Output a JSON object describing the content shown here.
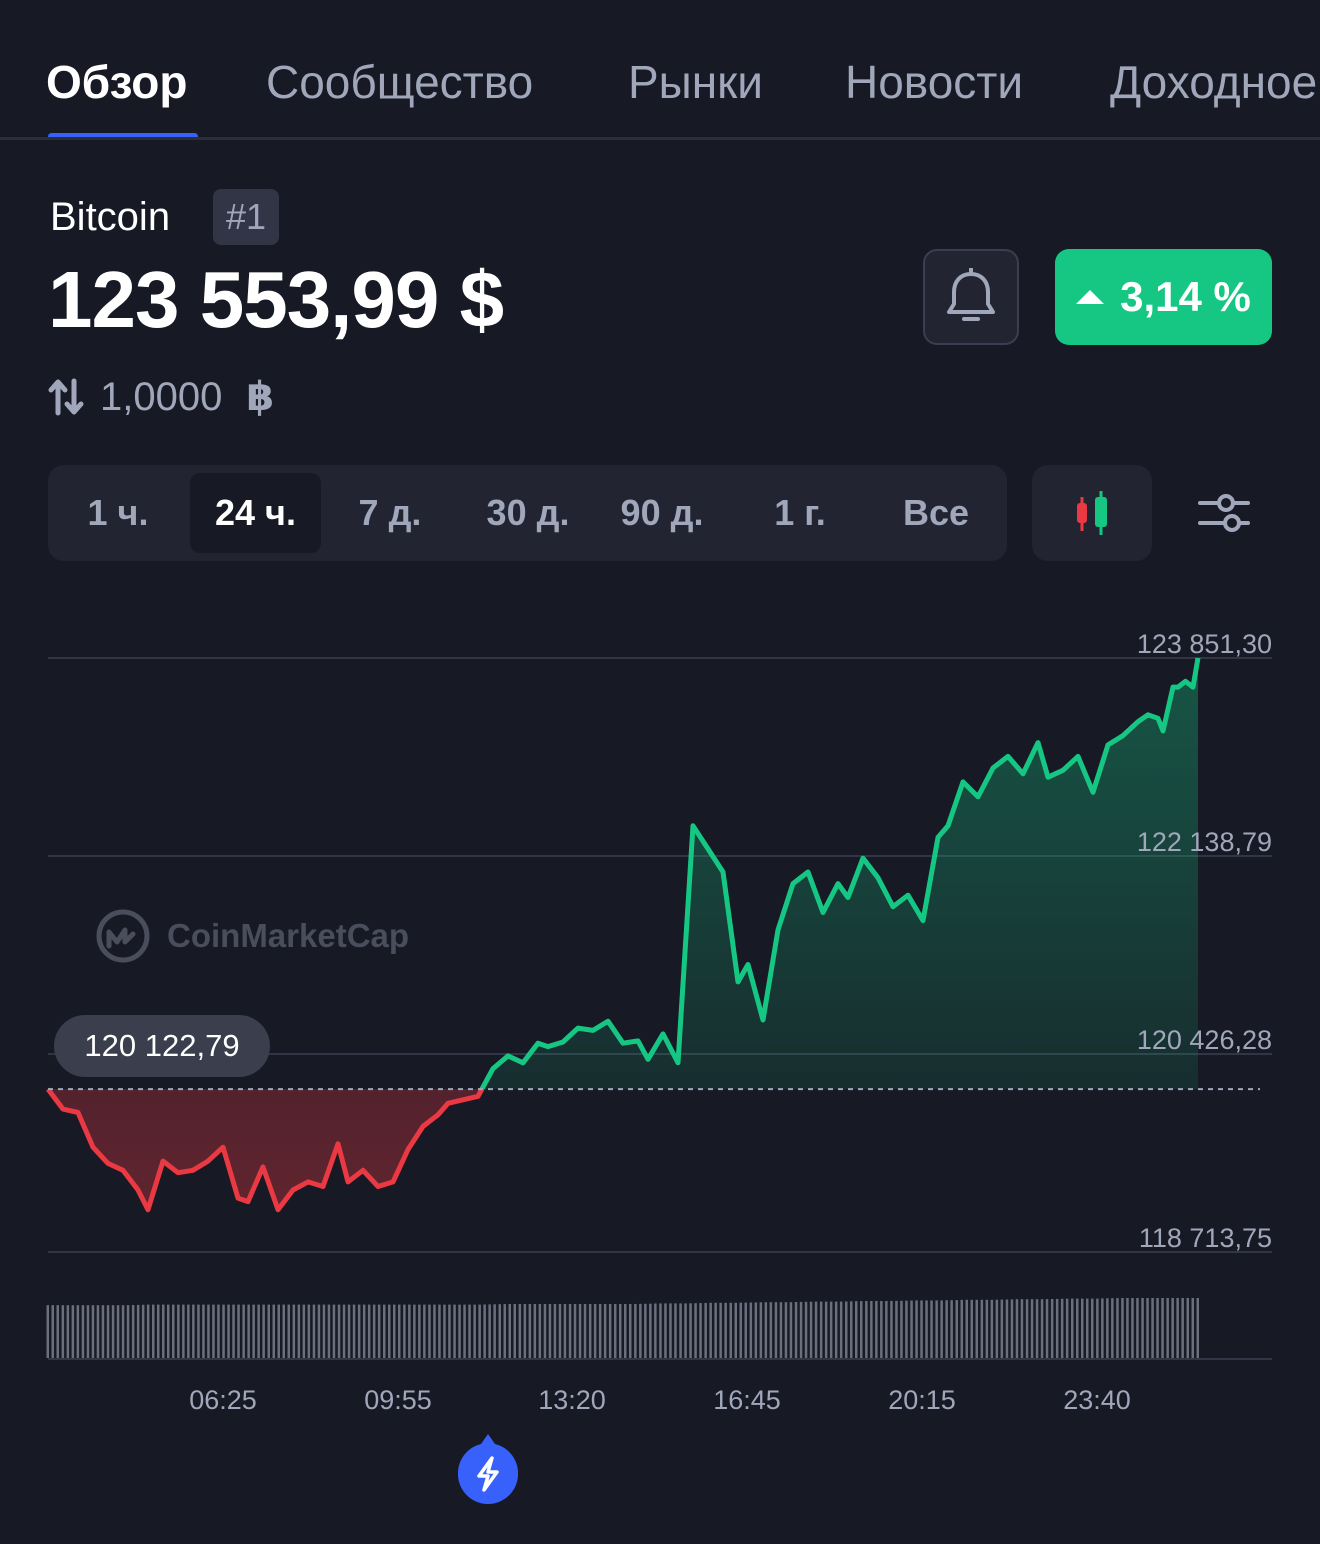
{
  "tabs": [
    {
      "label": "Обзор",
      "active": true
    },
    {
      "label": "Сообщество",
      "active": false
    },
    {
      "label": "Рынки",
      "active": false
    },
    {
      "label": "Новости",
      "active": false
    },
    {
      "label": "Доходное",
      "active": false
    }
  ],
  "coin": {
    "name": "Bitcoin",
    "rank": "#1",
    "price": "123 553,99 $"
  },
  "change": {
    "value": "3,14 %",
    "direction": "up",
    "color": "#16c784"
  },
  "conversion": {
    "amount": "1,0000",
    "symbol": "฿"
  },
  "time_ranges": [
    {
      "label": "1 ч.",
      "active": false
    },
    {
      "label": "24 ч.",
      "active": true
    },
    {
      "label": "7 д.",
      "active": false
    },
    {
      "label": "30 д.",
      "active": false
    },
    {
      "label": "90 д.",
      "active": false
    },
    {
      "label": "1 г.",
      "active": false
    },
    {
      "label": "Все",
      "active": false
    }
  ],
  "icons": {
    "alert": "bell-icon",
    "chart_type": "candlestick-icon",
    "settings": "sliders-icon",
    "float": "lightning-icon",
    "watermark": "coinmarketcap-logo-icon"
  },
  "watermark": "CoinMarketCap",
  "colors": {
    "up": "#16c784",
    "down": "#ea3943",
    "accent": "#3861fb",
    "background": "#171924"
  },
  "chart_data": {
    "type": "area",
    "open_price": 120122.79,
    "open_price_label": "120 122,79",
    "y_ticks": [
      {
        "value": 123851.3,
        "label": "123 851,30"
      },
      {
        "value": 122138.79,
        "label": "122 138,79"
      },
      {
        "value": 120426.28,
        "label": "120 426,28"
      },
      {
        "value": 118713.75,
        "label": "118 713,75"
      }
    ],
    "ylim": [
      118713.75,
      123851.3
    ],
    "x_ticks": [
      "06:25",
      "09:55",
      "13:20",
      "16:45",
      "20:15",
      "23:40"
    ],
    "xlim_hours": [
      3.0,
      26.0
    ],
    "x_tick_hours": [
      6.417,
      9.917,
      13.333,
      16.75,
      20.25,
      23.667
    ],
    "series": [
      {
        "x": [
          3.0,
          3.3,
          3.6,
          3.9,
          4.2,
          4.5,
          4.8,
          5.0,
          5.3,
          5.6,
          5.9,
          6.2,
          6.5,
          6.8,
          7.0,
          7.3,
          7.6,
          7.9,
          8.2,
          8.5,
          8.8,
          9.0,
          9.3,
          9.6,
          9.9,
          10.2,
          10.5,
          10.8,
          11.0,
          11.3,
          11.6,
          11.9,
          12.2,
          12.5,
          12.8,
          13.0,
          13.3,
          13.6,
          13.9,
          14.2,
          14.5,
          14.8,
          15.0,
          15.3,
          15.6,
          15.9,
          16.2,
          16.5,
          16.8,
          17.0,
          17.3,
          17.6,
          17.9,
          18.2,
          18.5,
          18.8,
          19.0,
          19.3,
          19.6,
          19.9,
          20.2,
          20.5,
          20.8,
          21.0,
          21.3,
          21.6,
          21.9,
          22.2,
          22.5,
          22.8,
          23.0,
          23.3,
          23.6,
          23.9,
          24.2,
          24.5,
          24.8,
          25.0,
          25.2,
          25.3,
          25.5,
          25.6,
          25.75,
          25.9,
          26.0
        ],
        "y": [
          120122.79,
          119950,
          119920,
          119620,
          119480,
          119420,
          119250,
          119080,
          119500,
          119400,
          119420,
          119500,
          119620,
          119180,
          119150,
          119450,
          119080,
          119250,
          119320,
          119280,
          119650,
          119320,
          119420,
          119280,
          119320,
          119600,
          119800,
          119900,
          120000,
          120030,
          120060,
          120300,
          120410,
          120350,
          120520,
          120490,
          120530,
          120650,
          120630,
          120710,
          120520,
          120540,
          120380,
          120600,
          120350,
          122400,
          122200,
          122000,
          121050,
          121200,
          120720,
          121500,
          121900,
          122000,
          121650,
          121900,
          121780,
          122120,
          121950,
          121700,
          121800,
          121580,
          122300,
          122400,
          122780,
          122650,
          122900,
          123000,
          122850,
          123120,
          122820,
          122880,
          123000,
          122690,
          123100,
          123180,
          123300,
          123360,
          123330,
          123220,
          123600,
          123600,
          123650,
          123600,
          123851
        ]
      }
    ],
    "volume": [
      0.88,
      0.88,
      0.88,
      0.88,
      0.89,
      0.89,
      0.89,
      0.89,
      0.89,
      0.89,
      0.89,
      0.89,
      0.89,
      0.89,
      0.89,
      0.89,
      0.89,
      0.89,
      0.9,
      0.9,
      0.9,
      0.9,
      0.9,
      0.9,
      0.91,
      0.91,
      0.92,
      0.92,
      0.93,
      0.93,
      0.94,
      0.94,
      0.95,
      0.95,
      0.96,
      0.96,
      0.97,
      0.97,
      0.98,
      0.98,
      0.99,
      0.99,
      1.0,
      1.0,
      1.0,
      1.0
    ]
  }
}
